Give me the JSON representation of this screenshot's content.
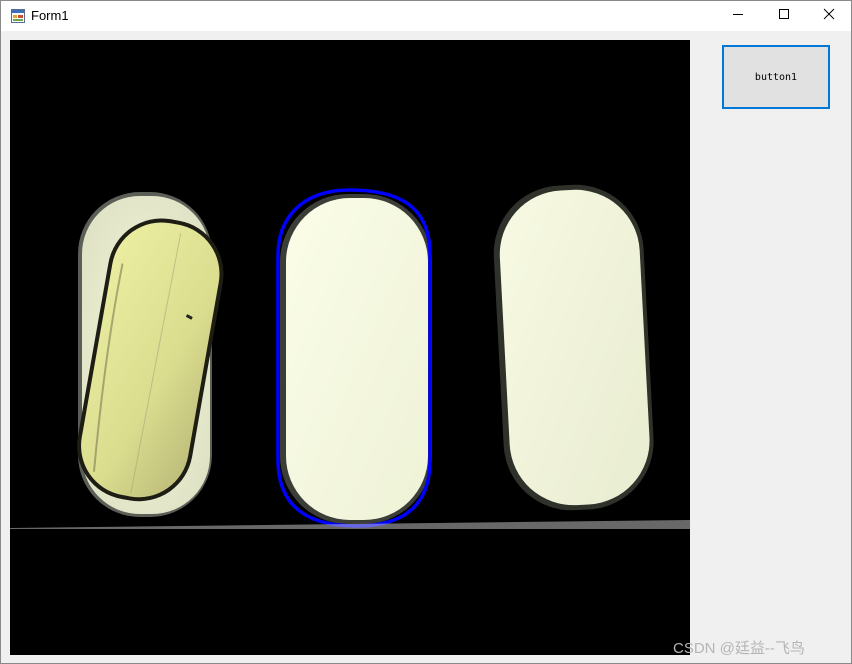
{
  "window": {
    "title": "Form1",
    "icons": {
      "app": "winforms-app-icon",
      "minimize": "minimize-icon",
      "maximize": "maximize-icon",
      "close": "close-icon"
    }
  },
  "form": {
    "button1_label": "button1"
  },
  "image": {
    "description_hidden": false,
    "contour_color": "#0000ff",
    "highlighted_capsule": "middle"
  },
  "watermark": {
    "text": "CSDN @廷益--飞鸟"
  },
  "colors": {
    "titlebar_bg": "#ffffff",
    "client_bg": "#f0f0f0",
    "button_border_focus": "#0078d7",
    "button_bg": "#e1e1e1",
    "image_bg": "#000000"
  }
}
